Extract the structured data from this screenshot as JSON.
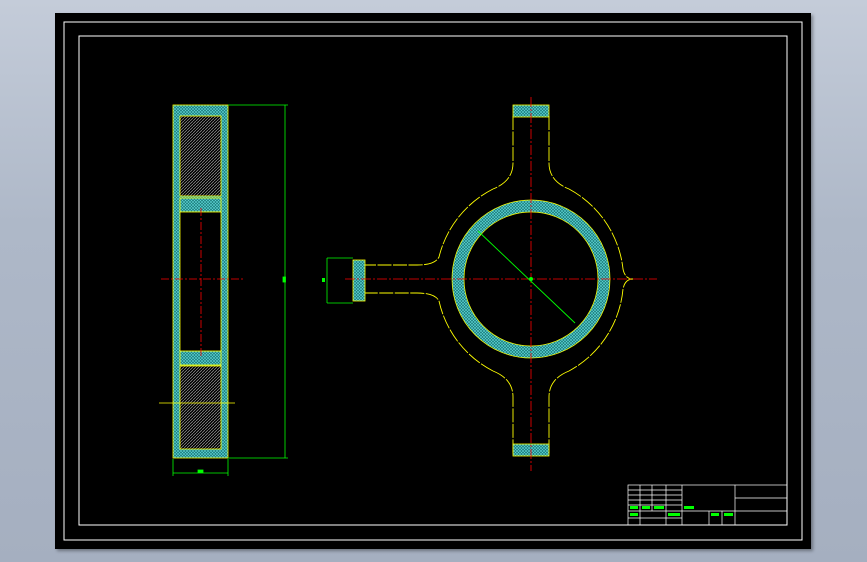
{
  "drawing": {
    "background_color": "#000000",
    "frame_color": "#ffffff",
    "outline_color_side_view": "#00ff00",
    "outline_color_plan_view": "#ffff00",
    "hatch_color": "#40c0c0",
    "centerline_color": "#ff0000",
    "dimension_color": "#00ff00"
  },
  "title_block": {
    "cells": [
      "",
      "",
      "",
      "",
      "",
      ""
    ]
  }
}
